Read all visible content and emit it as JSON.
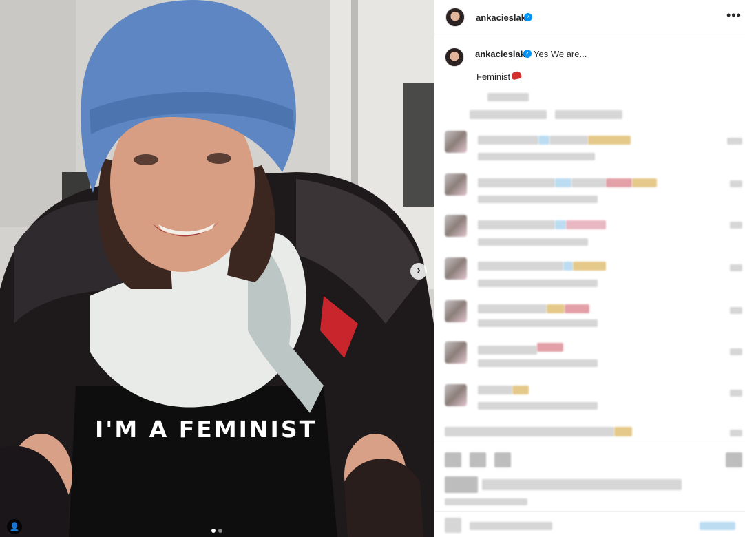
{
  "post": {
    "username": "ankacieslak",
    "more_label": "•••",
    "caption_text": "Yes We are...",
    "caption_line2": "Feminist",
    "shirt_text": "I'M A FEMINIST"
  },
  "photo": {
    "next_label": "›",
    "tag_label": "👤",
    "carousel_count": 2,
    "carousel_active": 1
  },
  "colors": {
    "verified": "#0095f6",
    "border": "#efefef",
    "beanie": "#5d86c2"
  },
  "icons": [
    "verified-badge-icon",
    "more-options-icon",
    "carousel-next-icon",
    "user-tag-icon",
    "red-heart-icon"
  ]
}
